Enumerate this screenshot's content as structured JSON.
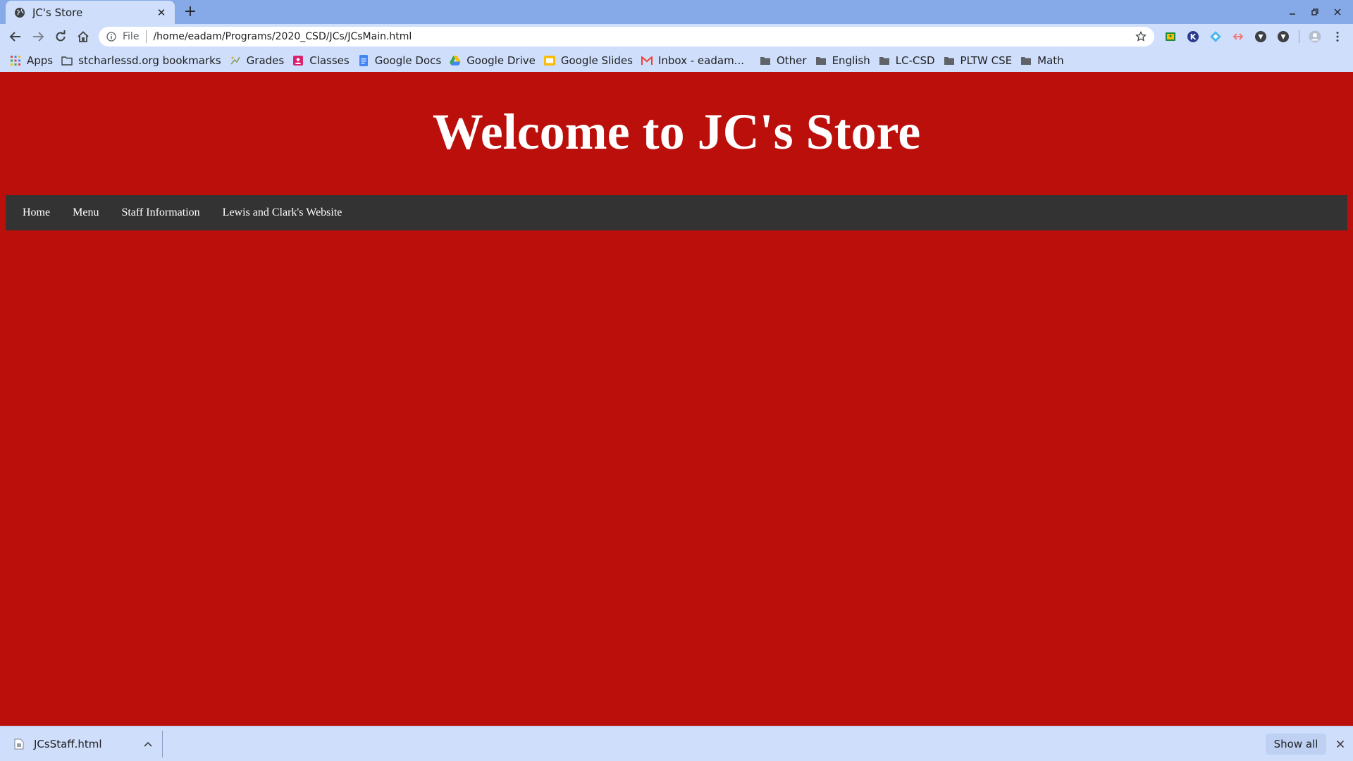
{
  "browser": {
    "tab": {
      "title": "JC's Store",
      "favicon": "globe-icon"
    },
    "toolbar": {
      "scheme": "File",
      "url": "/home/eadam/Programs/2020_CSD/JCs/JCsMain.html"
    },
    "bookmarks": [
      {
        "label": "Apps",
        "icon": "apps-grid-icon"
      },
      {
        "label": "stcharlessd.org bookmarks",
        "icon": "folder-icon"
      },
      {
        "label": "Grades",
        "icon": "grades-icon"
      },
      {
        "label": "Classes",
        "icon": "classes-icon"
      },
      {
        "label": "Google Docs",
        "icon": "google-docs-icon"
      },
      {
        "label": "Google Drive",
        "icon": "google-drive-icon"
      },
      {
        "label": "Google Slides",
        "icon": "google-slides-icon"
      },
      {
        "label": "Inbox - eadam...",
        "icon": "gmail-icon"
      },
      {
        "label": "Other",
        "icon": "folder-icon"
      },
      {
        "label": "English",
        "icon": "folder-icon"
      },
      {
        "label": "LC-CSD",
        "icon": "folder-icon"
      },
      {
        "label": "PLTW CSE",
        "icon": "folder-icon"
      },
      {
        "label": "Math",
        "icon": "folder-icon"
      }
    ],
    "download_shelf": {
      "filename": "JCsStaff.html",
      "show_all": "Show all"
    }
  },
  "page": {
    "heading": "Welcome to JC's Store",
    "nav": [
      "Home",
      "Menu",
      "Staff Information",
      "Lewis and Clark's Website"
    ],
    "colors": {
      "background": "#bb0f0b",
      "nav_bar": "#333333",
      "text": "#ffffff"
    }
  }
}
